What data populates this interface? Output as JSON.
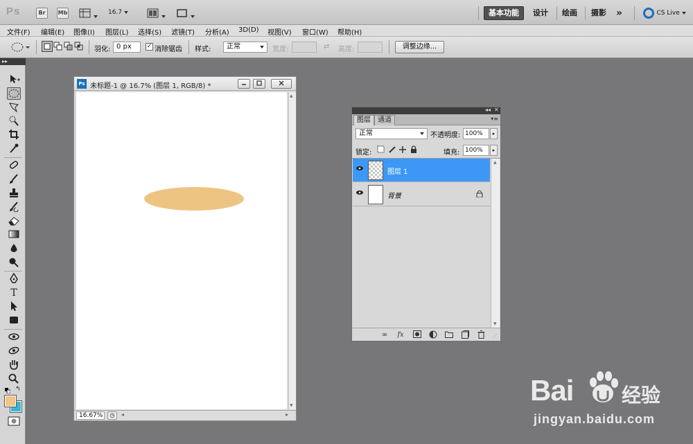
{
  "app": {
    "logo": "Ps",
    "bridge_label": "Br",
    "minibridge_label": "Mb",
    "zoom_value": "16.7",
    "workspaces": [
      "基本功能",
      "设计",
      "绘画",
      "摄影"
    ],
    "more_label": "»",
    "cslive_label": "CS Live"
  },
  "menu": [
    "文件(F)",
    "编辑(E)",
    "图像(I)",
    "图层(L)",
    "选择(S)",
    "滤镜(T)",
    "分析(A)",
    "3D(D)",
    "视图(V)",
    "窗口(W)",
    "帮助(H)"
  ],
  "options": {
    "feather_label": "羽化:",
    "feather_value": "0 px",
    "antialias_label": "消除锯齿",
    "antialias_checked": true,
    "style_label": "样式:",
    "style_value": "正常",
    "width_label": "宽度:",
    "height_label": "高度:",
    "refine_edge_label": "调整边缘..."
  },
  "document": {
    "title": "未标题-1 @ 16.7% (图层 1, RGB/8) *",
    "ps_icon": "Ps",
    "zoom_status": "16.67%",
    "ellipse_color": "#eec482"
  },
  "layers_panel": {
    "tabs": [
      "图层",
      "通道"
    ],
    "blend_mode": "正常",
    "opacity_label": "不透明度:",
    "opacity_value": "100%",
    "lock_label": "锁定:",
    "fill_label": "填充:",
    "fill_value": "100%",
    "layers": [
      {
        "name": "图层 1",
        "selected": true
      },
      {
        "name": "背景",
        "selected": false,
        "locked": true
      }
    ]
  },
  "colors": {
    "foreground": "#f0c585",
    "background": "#36b7d3",
    "selection_highlight": "#3d98f5"
  },
  "watermark": {
    "brand": "Bai",
    "brand_cn": "经验",
    "url": "jingyan.baidu.com"
  }
}
